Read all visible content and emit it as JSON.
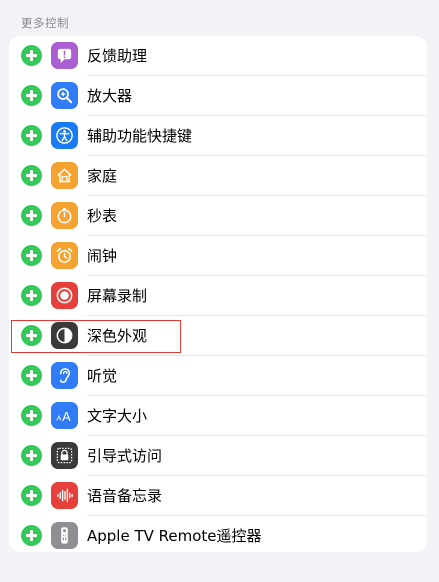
{
  "section": {
    "header": "更多控制"
  },
  "accent_add_color": "#34c759",
  "highlight_color": "#e53935",
  "items": [
    {
      "label": "反馈助理",
      "icon": "feedback-icon",
      "color": "#a95ed2"
    },
    {
      "label": "放大器",
      "icon": "magnifier-icon",
      "color": "#2f7cf6"
    },
    {
      "label": "辅助功能快捷键",
      "icon": "accessibility-icon",
      "color": "#1a7cf5"
    },
    {
      "label": "家庭",
      "icon": "home-icon",
      "color": "#f4a230"
    },
    {
      "label": "秒表",
      "icon": "stopwatch-icon",
      "color": "#f4a230"
    },
    {
      "label": "闹钟",
      "icon": "alarm-icon",
      "color": "#f4a230"
    },
    {
      "label": "屏幕录制",
      "icon": "screen-record-icon",
      "color": "#e5403a"
    },
    {
      "label": "深色外观",
      "icon": "dark-mode-icon",
      "color": "#3a3a3c"
    },
    {
      "label": "听觉",
      "icon": "hearing-icon",
      "color": "#2f7cf6"
    },
    {
      "label": "文字大小",
      "icon": "text-size-icon",
      "color": "#2f7cf6"
    },
    {
      "label": "引导式访问",
      "icon": "guided-access-icon",
      "color": "#3a3a3c"
    },
    {
      "label": "语音备忘录",
      "icon": "voice-memo-icon",
      "color": "#e5403a"
    },
    {
      "label": "Apple TV Remote遥控器",
      "icon": "tv-remote-icon",
      "color": "#8e8e93"
    }
  ]
}
